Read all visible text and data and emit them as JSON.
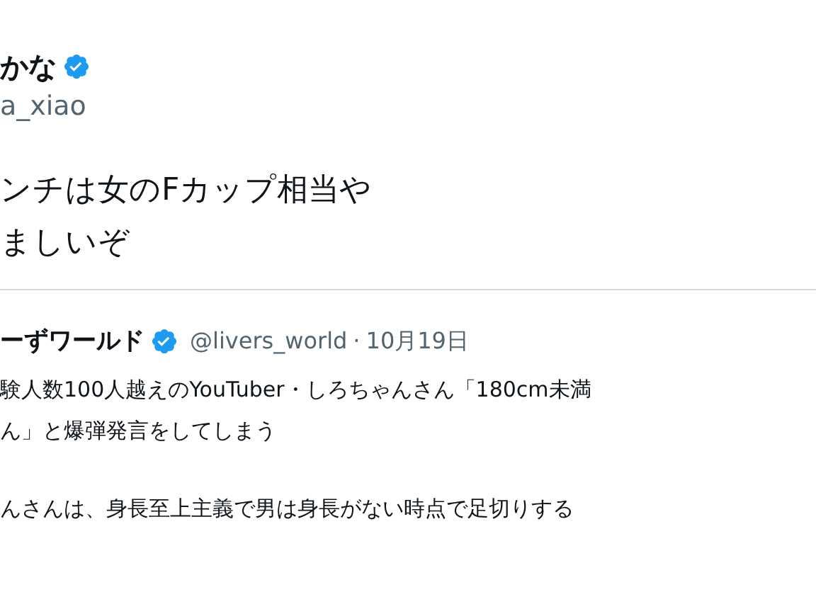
{
  "author": {
    "name": "かな",
    "verified": true,
    "handle": "a_xiao"
  },
  "tweet_text": [
    "ンチは女のFカップ相当や",
    "ましいぞ"
  ],
  "quoted_tweet": {
    "name": "ーずワールド",
    "verified": true,
    "handle": "@livers_world",
    "separator": "·",
    "date": "10月19日",
    "title_lines": [
      "験人数100人越えのYouTuber・しろちゃんさん「180cm未満",
      "ん」と爆弾発言をしてしまう"
    ],
    "body": "んさんは、身長至上主義で男は身長がない時点で足切りする"
  }
}
